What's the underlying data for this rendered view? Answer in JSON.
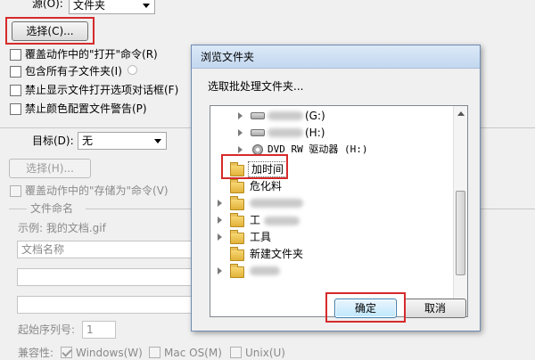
{
  "source": {
    "label": "源(O):",
    "value": "文件夹"
  },
  "choose_button": "选择(C)...",
  "options": [
    {
      "label": "覆盖动作中的\"打开\"命令(R)"
    },
    {
      "label": "包含所有子文件夹(I)"
    },
    {
      "label": "禁止显示文件打开选项对话框(F)"
    },
    {
      "label": "禁止颜色配置文件警告(P)"
    }
  ],
  "target": {
    "label": "目标(D):",
    "value": "无"
  },
  "target_choose_button": "选择(H)...",
  "override_save": "覆盖动作中的\"存储为\"命令(V)",
  "file_naming": {
    "title": "文件命名",
    "example": "示例: 我的文档.gif",
    "field1": "文档名称",
    "start_serial_label": "起始序列号:",
    "start_serial_value": "1",
    "compat_label": "兼容性:",
    "compat": [
      "Windows(W)",
      "Mac OS(M)",
      "Unix(U)"
    ]
  },
  "dialog": {
    "title": "浏览文件夹",
    "prompt": "选取批处理文件夹...",
    "tree": [
      {
        "label": "(G:)"
      },
      {
        "label": "(H:)"
      },
      {
        "label": "DVD RW 驱动器 (H:)"
      },
      {
        "label": "加时间"
      },
      {
        "label": "危化料"
      },
      {
        "label": ""
      },
      {
        "label": "工"
      },
      {
        "label": "工具"
      },
      {
        "label": "新建文件夹"
      },
      {
        "label": ""
      }
    ],
    "ok": "确定",
    "cancel": "取消"
  },
  "colors": {
    "highlight_red": "#d62a2a"
  }
}
